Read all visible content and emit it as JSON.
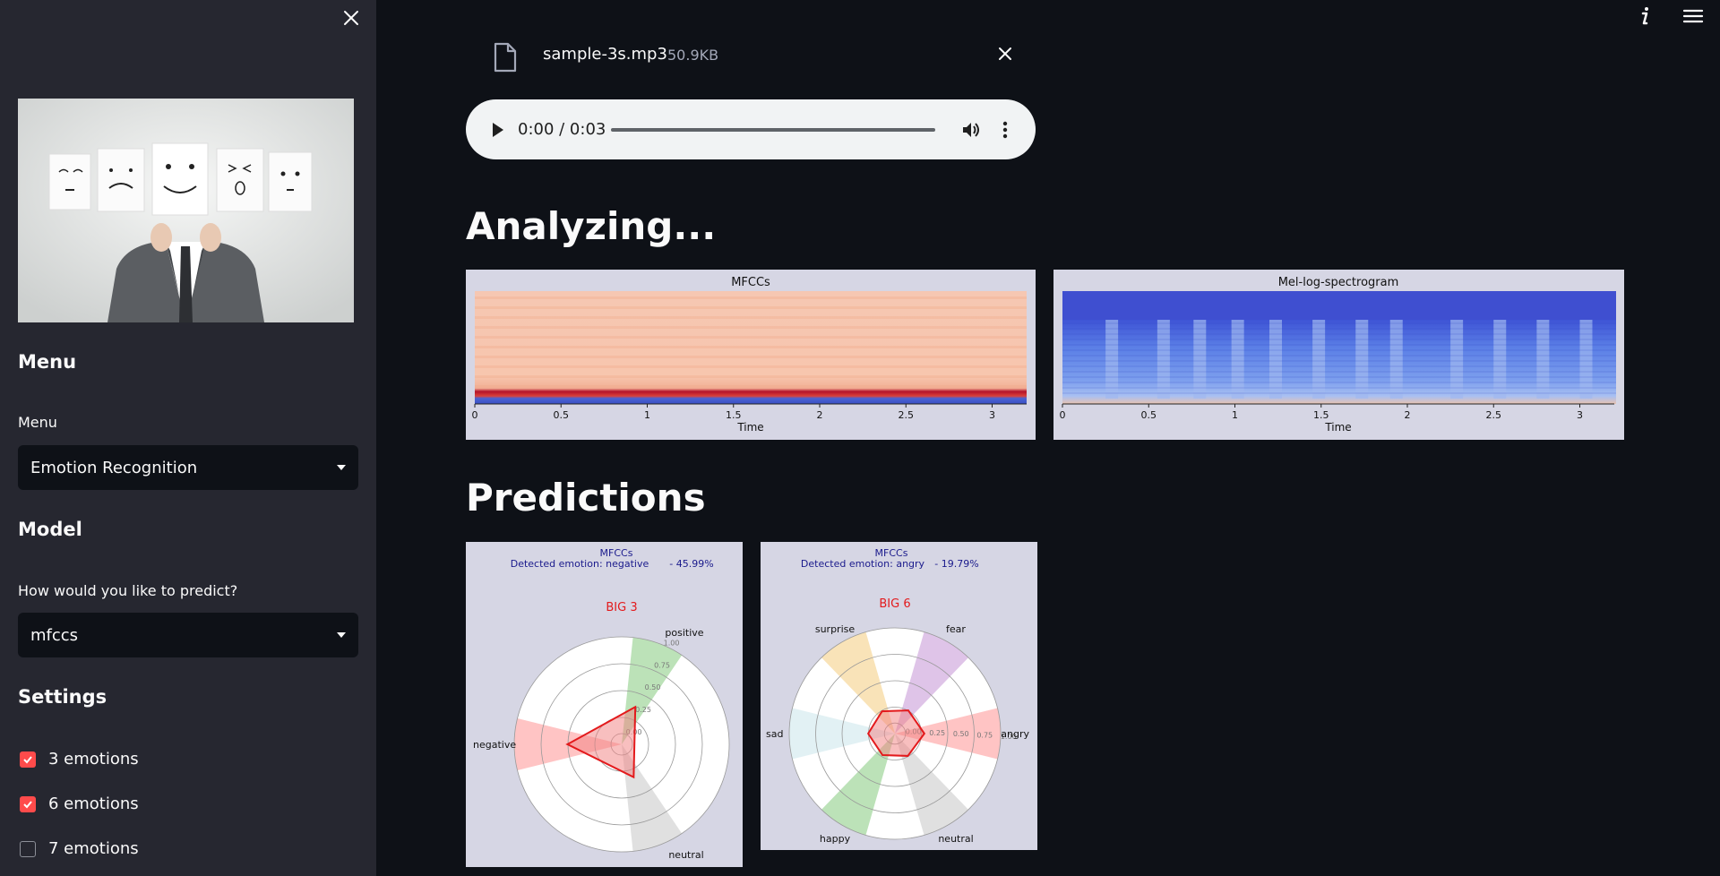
{
  "sidebar": {
    "menu_heading": "Menu",
    "menu_label": "Menu",
    "menu_value": "Emotion Recognition",
    "model_heading": "Model",
    "predict_label": "How would you like to predict?",
    "predict_value": "mfccs",
    "settings_heading": "Settings",
    "checkboxes": [
      {
        "label": "3 emotions",
        "checked": true
      },
      {
        "label": "6 emotions",
        "checked": true
      },
      {
        "label": "7 emotions",
        "checked": false
      }
    ]
  },
  "file": {
    "name": "sample-3s.mp3",
    "size": "50.9KB"
  },
  "audio": {
    "time": "0:00 / 0:03"
  },
  "analyzing_title": "Analyzing...",
  "predictions_title": "Predictions",
  "colors": {
    "accent": "#ff4b4b",
    "bg": "#0e1117",
    "sidebar": "#262730",
    "panel": "#d6d6e4"
  },
  "chart_data": [
    {
      "type": "heatmap",
      "title": "MFCCs",
      "xlabel": "Time",
      "xticks": [
        "0",
        "0.5",
        "1",
        "1.5",
        "2",
        "2.5",
        "3"
      ]
    },
    {
      "type": "heatmap",
      "title": "Mel-log-spectrogram",
      "xlabel": "Time",
      "xticks": [
        "0",
        "0.5",
        "1",
        "1.5",
        "2",
        "2.5",
        "3"
      ]
    },
    {
      "type": "radar",
      "header": "MFCCs",
      "detected": "Detected emotion: negative",
      "percent": "- 45.99%",
      "title": "BIG 3",
      "categories": [
        "positive",
        "negative",
        "neutral"
      ],
      "values": [
        0.3,
        0.45,
        0.25
      ],
      "rticks": [
        "0.00",
        "0.25",
        "0.50",
        "0.75",
        "1.00"
      ]
    },
    {
      "type": "radar",
      "header": "MFCCs",
      "detected": "Detected emotion: angry",
      "percent": "- 19.79%",
      "title": "BIG 6",
      "categories": [
        "angry",
        "fear",
        "surprise",
        "sad",
        "happy",
        "neutral"
      ],
      "values": [
        0.198,
        0.17,
        0.16,
        0.17,
        0.15,
        0.16
      ],
      "rticks": [
        "0.00",
        "0.25",
        "0.50",
        "0.75",
        "1.00"
      ]
    }
  ]
}
